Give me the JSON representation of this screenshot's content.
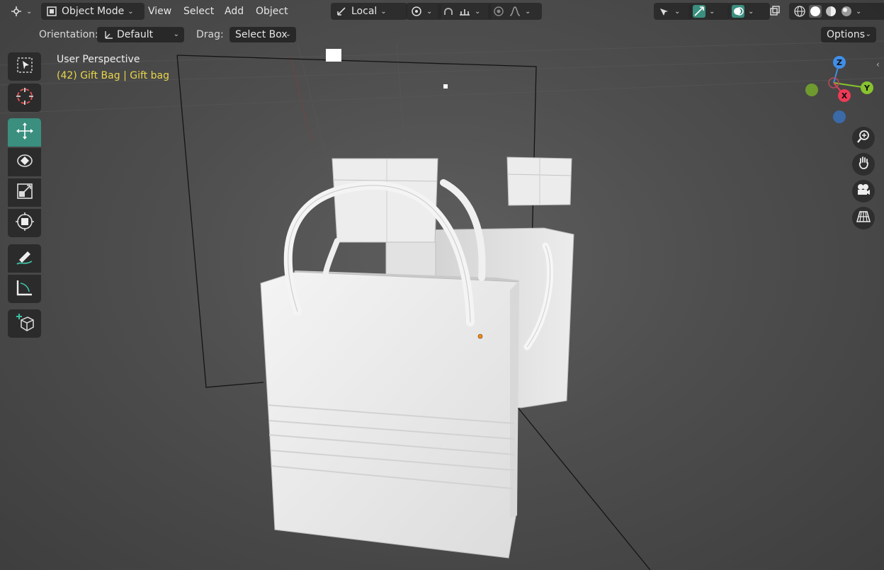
{
  "header": {
    "editor_type_icon": "editor-type-icon",
    "mode_label": "Object Mode",
    "menus": [
      "View",
      "Select",
      "Add",
      "Object"
    ],
    "transform_pivot_label": "Local"
  },
  "tool_settings": {
    "orientation_label": "Orientation:",
    "orientation_value": "Default",
    "drag_label": "Drag:",
    "drag_value": "Select Box",
    "options_label": "Options"
  },
  "viewport": {
    "perspective_label": "User Perspective",
    "object_info": "(42) Gift Bag | Gift bag"
  },
  "gizmo": {
    "z_label": "Z",
    "y_label": "Y",
    "x_label": "X"
  },
  "tools": [
    "select-box-icon",
    "cursor-icon",
    "move-icon",
    "rotate-icon",
    "scale-icon",
    "transform-icon",
    "annotate-icon",
    "measure-icon",
    "add-cube-icon"
  ],
  "colors": {
    "accent": "#3a8f7f",
    "info_text": "#e8d64a",
    "axis_x": "#ee3a57",
    "axis_y": "#88c32f",
    "axis_z": "#3f8fe8"
  }
}
